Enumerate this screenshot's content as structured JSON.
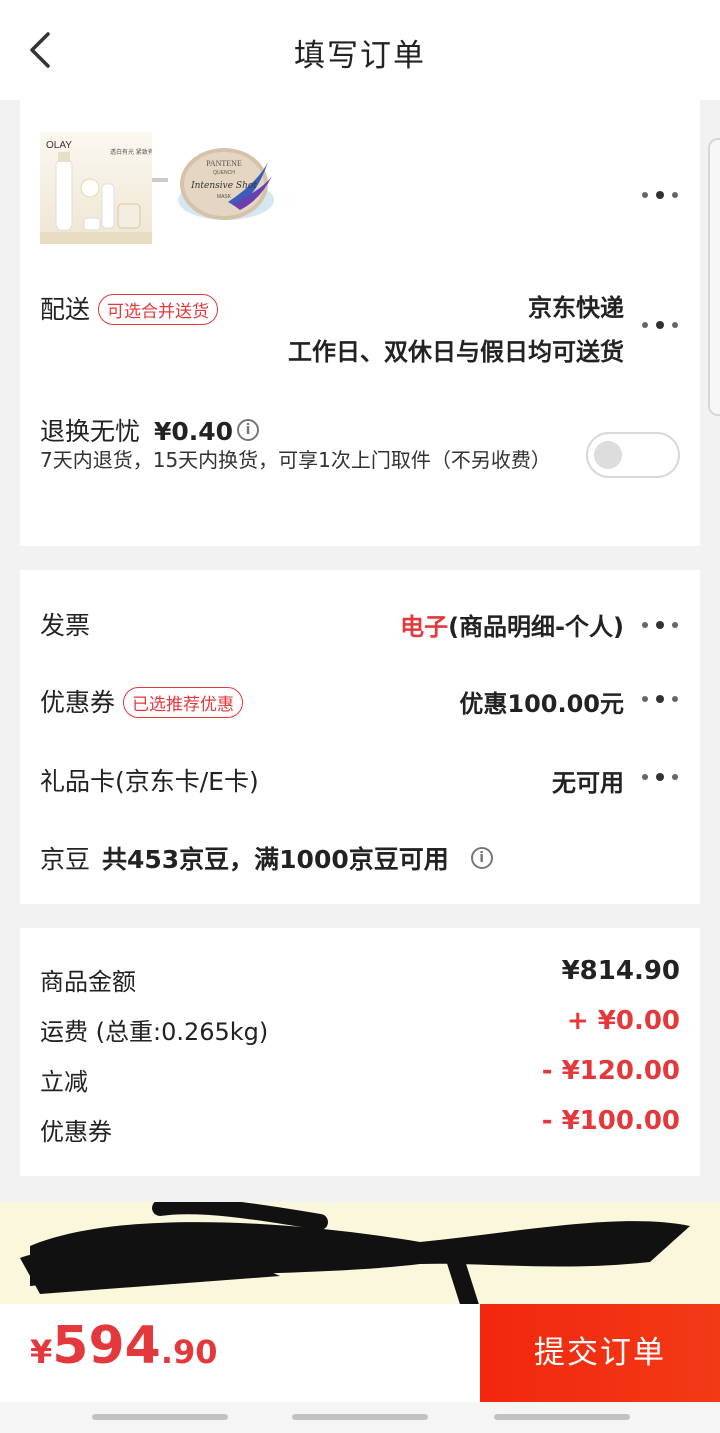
{
  "header": {
    "title": "填写订单",
    "back_icon": "back-arrow-icon"
  },
  "products": {
    "thumb1": {
      "brand": "OLAY",
      "tagline": "透白有光 紧致有度"
    },
    "thumb2": {
      "brand": "PANTENE",
      "line": "QUENCH",
      "product": "Intensive Shot",
      "type": "MASK"
    }
  },
  "delivery": {
    "label": "配送",
    "badge": "可选合并送货",
    "carrier": "京东快递",
    "schedule": "工作日、双休日与假日均可送货"
  },
  "return_service": {
    "label": "退换无忧",
    "price": "¥0.40",
    "description": "7天内退货，15天内换货，可享1次上门取件（不另收费）",
    "enabled": false
  },
  "invoice": {
    "label": "发票",
    "type": "电子",
    "detail": "(商品明细-个人)"
  },
  "coupon": {
    "label": "优惠券",
    "badge": "已选推荐优惠",
    "value": "优惠100.00元"
  },
  "gift_card": {
    "label": "礼品卡(京东卡/E卡)",
    "value": "无可用"
  },
  "jingdou": {
    "label": "京豆",
    "value": "共453京豆，满1000京豆可用"
  },
  "summary": [
    {
      "label": "商品金额",
      "value": "¥814.90",
      "tone": "normal"
    },
    {
      "label": "运费 (总重:0.265kg)",
      "value": "+ ¥0.00",
      "tone": "red"
    },
    {
      "label": "立减",
      "value": "- ¥120.00",
      "tone": "red"
    },
    {
      "label": "优惠券",
      "value": "- ¥100.00",
      "tone": "red"
    }
  ],
  "footer": {
    "total_currency": "¥",
    "total_integer": "594",
    "total_decimal": ".90",
    "submit_label": "提交订单"
  },
  "colors": {
    "accent": "#e4393c",
    "submit": "#f2270c",
    "banner": "#fbf7dc"
  }
}
